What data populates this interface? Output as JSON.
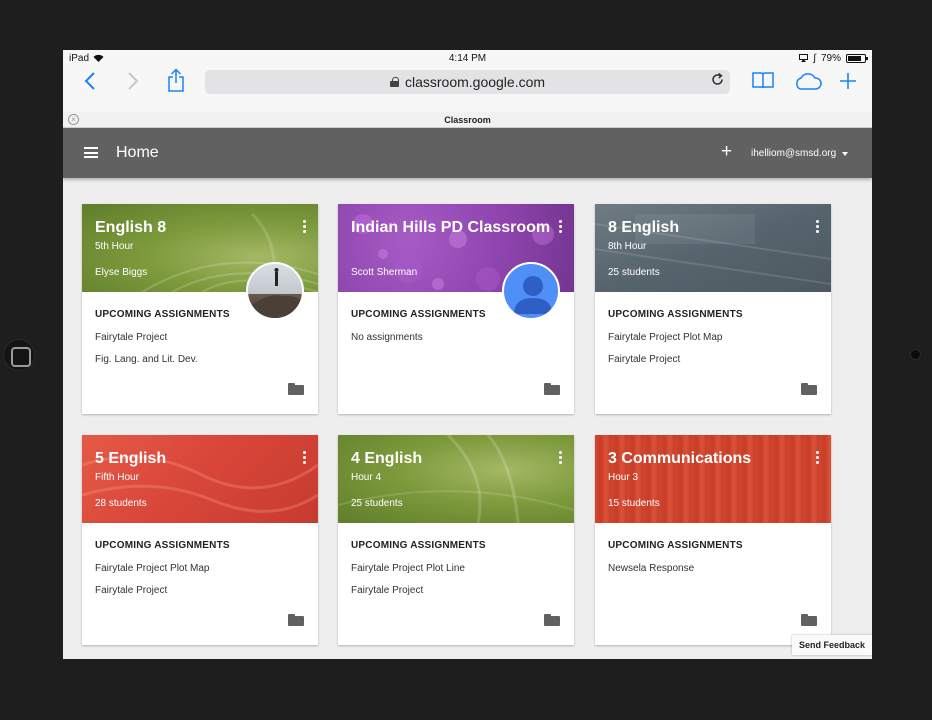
{
  "status_bar": {
    "device": "iPad",
    "time": "4:14 PM",
    "battery": "79%"
  },
  "browser": {
    "url": "classroom.google.com",
    "tab_title": "Classroom"
  },
  "app_header": {
    "title": "Home",
    "account": "ihelliom@smsd.org"
  },
  "section_label": "UPCOMING ASSIGNMENTS",
  "cards": [
    {
      "name": "English 8",
      "section": "5th Hour",
      "subtitle": "Elyse Biggs",
      "assignments": [
        "Fairytale Project",
        "Fig. Lang. and Lit. Dev."
      ],
      "color": "#7d9a3c"
    },
    {
      "name": "Indian Hills PD Classroom",
      "section": "",
      "subtitle": "Scott Sherman",
      "assignments": [
        "No assignments"
      ],
      "color": "#8e44ad"
    },
    {
      "name": "8 English",
      "section": "8th Hour",
      "subtitle": "25 students",
      "assignments": [
        "Fairytale Project Plot Map",
        "Fairytale Project"
      ],
      "color": "#5b6a73"
    },
    {
      "name": "5 English",
      "section": "Fifth Hour",
      "subtitle": "28 students",
      "assignments": [
        "Fairytale Project Plot Map",
        "Fairytale Project"
      ],
      "color": "#d9473a"
    },
    {
      "name": "4 English",
      "section": "Hour 4",
      "subtitle": "25 students",
      "assignments": [
        "Fairytale Project Plot Line",
        "Fairytale Project"
      ],
      "color": "#7d9a3c"
    },
    {
      "name": "3 Communications",
      "section": "Hour 3",
      "subtitle": "15 students",
      "assignments": [
        "Newsela Response"
      ],
      "color": "#d2452f"
    }
  ],
  "feedback_label": "Send Feedback"
}
